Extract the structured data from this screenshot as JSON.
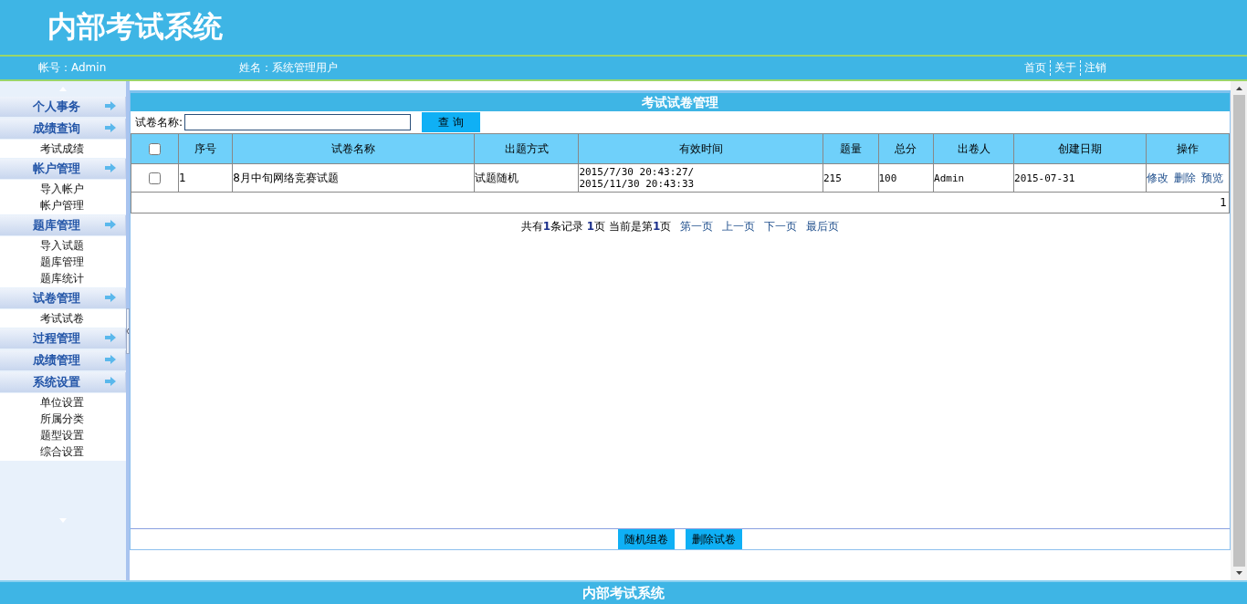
{
  "header": {
    "title": "内部考试系统"
  },
  "info_bar": {
    "account": "帐号：Admin",
    "name": "姓名：系统管理用户",
    "links": [
      "首页",
      "关于",
      "注销"
    ]
  },
  "sidebar": {
    "groups": [
      {
        "title": "个人事务"
      },
      {
        "title": "成绩查询",
        "items": [
          "考试成绩"
        ]
      },
      {
        "title": "帐户管理",
        "items": [
          "导入帐户",
          "帐户管理"
        ]
      },
      {
        "title": "题库管理",
        "items": [
          "导入试题",
          "题库管理",
          "题库统计"
        ]
      },
      {
        "title": "试卷管理",
        "items": [
          "考试试卷"
        ]
      },
      {
        "title": "过程管理"
      },
      {
        "title": "成绩管理"
      },
      {
        "title": "系统设置",
        "items": [
          "单位设置",
          "所属分类",
          "题型设置",
          "综合设置"
        ]
      }
    ]
  },
  "panel": {
    "title": "考试试卷管理",
    "search": {
      "label": "试卷名称:",
      "button": "查 询"
    },
    "table": {
      "columns": [
        "序号",
        "试卷名称",
        "出题方式",
        "有效时间",
        "题量",
        "总分",
        "出卷人",
        "创建日期",
        "操作"
      ],
      "header_checked": false,
      "rows": [
        {
          "checked": false,
          "cells": [
            "1",
            "8月中旬网络竞赛试题",
            "试题随机",
            "2015/7/30 20:43:27/\n2015/11/30 20:43:33",
            "215",
            "100",
            "Admin",
            "2015-07-31"
          ],
          "actions": [
            "修改",
            "删除",
            "预览"
          ]
        }
      ],
      "footer": "1"
    },
    "pager": {
      "summary": "共有**1**条记录 **1**页 当前是第**1**页",
      "links": [
        "第一页",
        "上一页",
        "下一页",
        "最后页"
      ]
    },
    "buttons": [
      "随机组卷",
      "删除试卷"
    ]
  },
  "footer": {
    "title": "内部考试系统"
  }
}
